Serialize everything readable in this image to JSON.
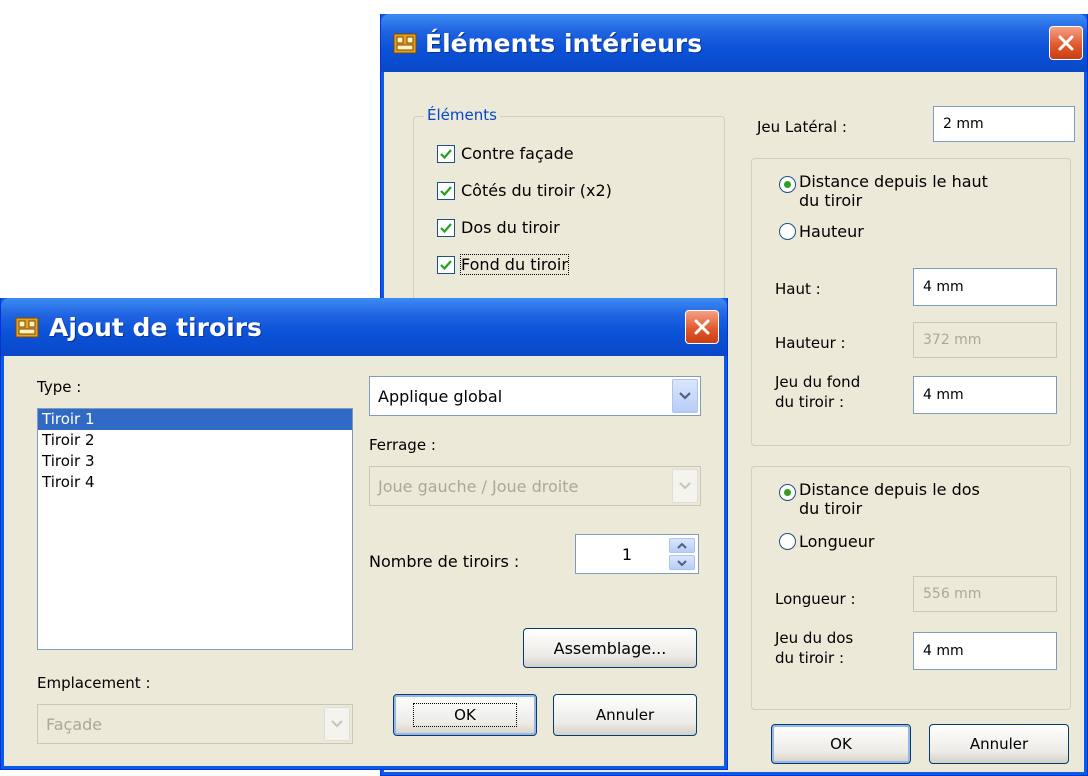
{
  "elements_dialog": {
    "title": "Éléments intérieurs",
    "group_title": "Éléments",
    "checkboxes": [
      {
        "label": "Contre façade",
        "checked": true
      },
      {
        "label": "Côtés du tiroir (x2)",
        "checked": true
      },
      {
        "label": "Dos du tiroir",
        "checked": true
      },
      {
        "label": "Fond du tiroir",
        "checked": true
      }
    ],
    "jeu_lateral_label": "Jeu Latéral :",
    "jeu_lateral_value": "2 mm",
    "height_group": {
      "radio_distance_line1": "Distance depuis le haut",
      "radio_distance_line2": "du tiroir",
      "radio_hauteur": "Hauteur",
      "haut_label": "Haut :",
      "haut_value": "4 mm",
      "hauteur_label": "Hauteur :",
      "hauteur_value": "372 mm",
      "jeu_fond_label_line1": "Jeu du fond",
      "jeu_fond_label_line2": "du tiroir :",
      "jeu_fond_value": "4 mm"
    },
    "length_group": {
      "radio_distance_line1": "Distance depuis le dos",
      "radio_distance_line2": "du tiroir",
      "radio_longueur": "Longueur",
      "longueur_label": "Longueur :",
      "longueur_value": "556 mm",
      "jeu_dos_label_line1": "Jeu du dos",
      "jeu_dos_label_line2": "du tiroir :",
      "jeu_dos_value": "4 mm"
    },
    "ok_label": "OK",
    "cancel_label": "Annuler"
  },
  "tiroirs_dialog": {
    "title": "Ajout de tiroirs",
    "type_label": "Type :",
    "items": [
      "Tiroir 1",
      "Tiroir 2",
      "Tiroir 3",
      "Tiroir 4"
    ],
    "applique_value": "Applique global",
    "ferrage_label": "Ferrage :",
    "ferrage_value": "Joue gauche / Joue droite",
    "nombre_label": "Nombre de tiroirs :",
    "nombre_value": "1",
    "assemblage_label": "Assemblage...",
    "emplacement_label": "Emplacement :",
    "emplacement_value": "Façade",
    "ok_label": "OK",
    "cancel_label": "Annuler"
  }
}
